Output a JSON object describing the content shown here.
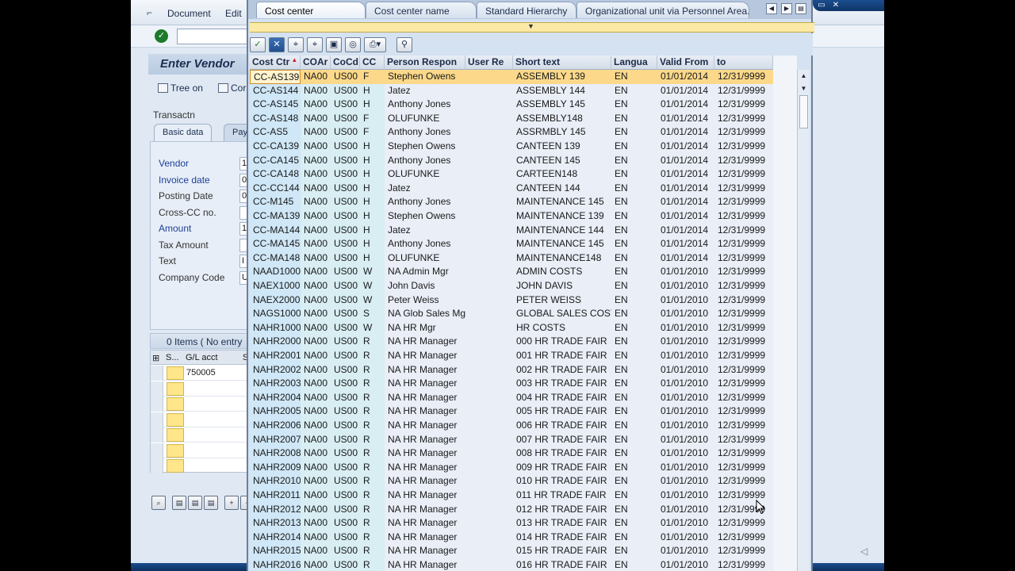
{
  "menu": {
    "document": "Document",
    "edit": "Edit"
  },
  "background": {
    "title": "Enter Vendor",
    "tools": {
      "tree_on": "Tree on",
      "con": "Cor"
    },
    "transactn": "Transactn",
    "tabs": {
      "basic_data": "Basic data",
      "pay": "Pay"
    },
    "fields": [
      {
        "label": "Vendor",
        "value": "1",
        "blue": true
      },
      {
        "label": "Invoice date",
        "value": "0",
        "blue": true
      },
      {
        "label": "Posting Date",
        "value": "0",
        "blue": false
      },
      {
        "label": "Cross-CC no.",
        "value": "",
        "blue": false
      },
      {
        "label": "Amount",
        "value": "1",
        "blue": true
      },
      {
        "label": "Tax Amount",
        "value": "",
        "blue": false
      },
      {
        "label": "Text",
        "value": "I",
        "blue": false
      },
      {
        "label": "Company Code",
        "value": "U",
        "blue": false
      }
    ],
    "items_bar": "0 Items ( No entry",
    "item_head": {
      "s": "S...",
      "gl": "G/L acct",
      "s2": "S"
    },
    "item_first_gl": "750005"
  },
  "popup": {
    "tabs": [
      "Cost center",
      "Cost center name",
      "Standard Hierarchy",
      "Organizational unit via Personnel Area..."
    ],
    "active_tab": 0,
    "columns": [
      "Cost Ctr",
      "COAr",
      "CoCd",
      "CC",
      "Person Respon",
      "User Re",
      "Short text",
      "Langua",
      "Valid From",
      "to"
    ],
    "rows": [
      [
        "CC-AS139",
        "NA00",
        "US00",
        "F",
        "Stephen Owens",
        "",
        "ASSEMBLY 139",
        "EN",
        "01/01/2014",
        "12/31/9999"
      ],
      [
        "CC-AS144",
        "NA00",
        "US00",
        "H",
        "Jatez",
        "",
        "ASSEMBLY 144",
        "EN",
        "01/01/2014",
        "12/31/9999"
      ],
      [
        "CC-AS145",
        "NA00",
        "US00",
        "H",
        "Anthony Jones",
        "",
        "ASSEMBLY 145",
        "EN",
        "01/01/2014",
        "12/31/9999"
      ],
      [
        "CC-AS148",
        "NA00",
        "US00",
        "F",
        "OLUFUNKE",
        "",
        "ASSEMBLY148",
        "EN",
        "01/01/2014",
        "12/31/9999"
      ],
      [
        "CC-AS5",
        "NA00",
        "US00",
        "F",
        "Anthony Jones",
        "",
        "ASSRMBLY 145",
        "EN",
        "01/01/2014",
        "12/31/9999"
      ],
      [
        "CC-CA139",
        "NA00",
        "US00",
        "H",
        "Stephen Owens",
        "",
        "CANTEEN 139",
        "EN",
        "01/01/2014",
        "12/31/9999"
      ],
      [
        "CC-CA145",
        "NA00",
        "US00",
        "H",
        "Anthony Jones",
        "",
        "CANTEEN 145",
        "EN",
        "01/01/2014",
        "12/31/9999"
      ],
      [
        "CC-CA148",
        "NA00",
        "US00",
        "H",
        "OLUFUNKE",
        "",
        "CARTEEN148",
        "EN",
        "01/01/2014",
        "12/31/9999"
      ],
      [
        "CC-CC144",
        "NA00",
        "US00",
        "H",
        "Jatez",
        "",
        "CANTEEN 144",
        "EN",
        "01/01/2014",
        "12/31/9999"
      ],
      [
        "CC-M145",
        "NA00",
        "US00",
        "H",
        "Anthony Jones",
        "",
        "MAINTENANCE 145",
        "EN",
        "01/01/2014",
        "12/31/9999"
      ],
      [
        "CC-MA139",
        "NA00",
        "US00",
        "H",
        "Stephen Owens",
        "",
        "MAINTENANCE 139",
        "EN",
        "01/01/2014",
        "12/31/9999"
      ],
      [
        "CC-MA144",
        "NA00",
        "US00",
        "H",
        "Jatez",
        "",
        "MAINTENANCE 144",
        "EN",
        "01/01/2014",
        "12/31/9999"
      ],
      [
        "CC-MA145",
        "NA00",
        "US00",
        "H",
        "Anthony Jones",
        "",
        "MAINTENANCE 145",
        "EN",
        "01/01/2014",
        "12/31/9999"
      ],
      [
        "CC-MA148",
        "NA00",
        "US00",
        "H",
        "OLUFUNKE",
        "",
        "MAINTENANCE148",
        "EN",
        "01/01/2014",
        "12/31/9999"
      ],
      [
        "NAAD1000",
        "NA00",
        "US00",
        "W",
        "NA Admin Mgr",
        "",
        "ADMIN COSTS",
        "EN",
        "01/01/2010",
        "12/31/9999"
      ],
      [
        "NAEX1000",
        "NA00",
        "US00",
        "W",
        "John Davis",
        "",
        "JOHN DAVIS",
        "EN",
        "01/01/2010",
        "12/31/9999"
      ],
      [
        "NAEX2000",
        "NA00",
        "US00",
        "W",
        "Peter Weiss",
        "",
        "PETER WEISS",
        "EN",
        "01/01/2010",
        "12/31/9999"
      ],
      [
        "NAGS1000",
        "NA00",
        "US00",
        "S",
        "NA Glob Sales Mgr",
        "",
        "GLOBAL SALES COSTS",
        "EN",
        "01/01/2010",
        "12/31/9999"
      ],
      [
        "NAHR1000",
        "NA00",
        "US00",
        "W",
        "NA HR Mgr",
        "",
        "HR COSTS",
        "EN",
        "01/01/2010",
        "12/31/9999"
      ],
      [
        "NAHR2000",
        "NA00",
        "US00",
        "R",
        "NA HR Manager",
        "",
        "000 HR TRADE FAIR",
        "EN",
        "01/01/2010",
        "12/31/9999"
      ],
      [
        "NAHR2001",
        "NA00",
        "US00",
        "R",
        "NA HR Manager",
        "",
        "001 HR TRADE FAIR",
        "EN",
        "01/01/2010",
        "12/31/9999"
      ],
      [
        "NAHR2002",
        "NA00",
        "US00",
        "R",
        "NA HR Manager",
        "",
        "002 HR TRADE FAIR",
        "EN",
        "01/01/2010",
        "12/31/9999"
      ],
      [
        "NAHR2003",
        "NA00",
        "US00",
        "R",
        "NA HR Manager",
        "",
        "003 HR TRADE FAIR",
        "EN",
        "01/01/2010",
        "12/31/9999"
      ],
      [
        "NAHR2004",
        "NA00",
        "US00",
        "R",
        "NA HR Manager",
        "",
        "004 HR TRADE FAIR",
        "EN",
        "01/01/2010",
        "12/31/9999"
      ],
      [
        "NAHR2005",
        "NA00",
        "US00",
        "R",
        "NA HR Manager",
        "",
        "005 HR TRADE FAIR",
        "EN",
        "01/01/2010",
        "12/31/9999"
      ],
      [
        "NAHR2006",
        "NA00",
        "US00",
        "R",
        "NA HR Manager",
        "",
        "006 HR TRADE FAIR",
        "EN",
        "01/01/2010",
        "12/31/9999"
      ],
      [
        "NAHR2007",
        "NA00",
        "US00",
        "R",
        "NA HR Manager",
        "",
        "007 HR TRADE FAIR",
        "EN",
        "01/01/2010",
        "12/31/9999"
      ],
      [
        "NAHR2008",
        "NA00",
        "US00",
        "R",
        "NA HR Manager",
        "",
        "008 HR TRADE FAIR",
        "EN",
        "01/01/2010",
        "12/31/9999"
      ],
      [
        "NAHR2009",
        "NA00",
        "US00",
        "R",
        "NA HR Manager",
        "",
        "009 HR TRADE FAIR",
        "EN",
        "01/01/2010",
        "12/31/9999"
      ],
      [
        "NAHR2010",
        "NA00",
        "US00",
        "R",
        "NA HR Manager",
        "",
        "010 HR TRADE FAIR",
        "EN",
        "01/01/2010",
        "12/31/9999"
      ],
      [
        "NAHR2011",
        "NA00",
        "US00",
        "R",
        "NA HR Manager",
        "",
        "011 HR TRADE FAIR",
        "EN",
        "01/01/2010",
        "12/31/9999"
      ],
      [
        "NAHR2012",
        "NA00",
        "US00",
        "R",
        "NA HR Manager",
        "",
        "012 HR TRADE FAIR",
        "EN",
        "01/01/2010",
        "12/31/9999"
      ],
      [
        "NAHR2013",
        "NA00",
        "US00",
        "R",
        "NA HR Manager",
        "",
        "013 HR TRADE FAIR",
        "EN",
        "01/01/2010",
        "12/31/9999"
      ],
      [
        "NAHR2014",
        "NA00",
        "US00",
        "R",
        "NA HR Manager",
        "",
        "014 HR TRADE FAIR",
        "EN",
        "01/01/2010",
        "12/31/9999"
      ],
      [
        "NAHR2015",
        "NA00",
        "US00",
        "R",
        "NA HR Manager",
        "",
        "015 HR TRADE FAIR",
        "EN",
        "01/01/2010",
        "12/31/9999"
      ],
      [
        "NAHR2016",
        "NA00",
        "US00",
        "R",
        "NA HR Manager",
        "",
        "016 HR TRADE FAIR",
        "EN",
        "01/01/2010",
        "12/31/9999"
      ]
    ],
    "selected_row": 0,
    "toolbar_icons": [
      "checkmark-icon",
      "cancel-icon",
      "find-icon",
      "find-next-icon",
      "save-icon",
      "binoculars-icon",
      "print-icon",
      "personal-list-icon"
    ]
  },
  "colors": {
    "selected_row": "#fcd98a",
    "key_column": "#cfe7f7",
    "row_background": "#e9eef7"
  }
}
